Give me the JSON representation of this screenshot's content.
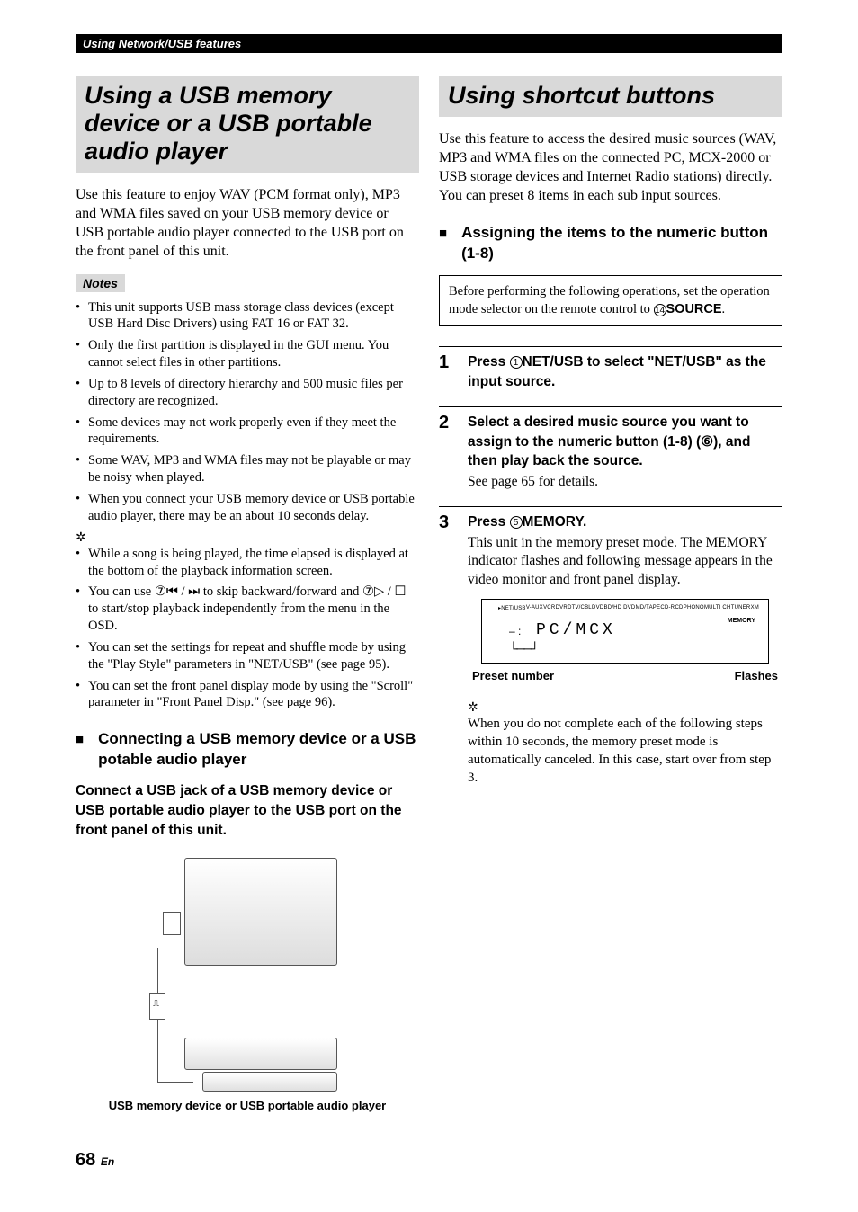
{
  "header": {
    "breadcrumb": "Using Network/USB features"
  },
  "left": {
    "title": "Using a USB memory device or a USB portable audio player",
    "intro": "Use this feature to enjoy WAV (PCM format only), MP3 and WMA files saved on your USB memory device or USB portable audio player connected to the USB port on the front panel of this unit.",
    "notes_label": "Notes",
    "notes": [
      "This unit supports USB mass storage class devices (except USB Hard Disc Drivers) using FAT 16 or FAT 32.",
      "Only the first partition is displayed in the GUI menu. You cannot select files in other partitions.",
      "Up to 8 levels of directory hierarchy and 500 music files per directory are recognized.",
      "Some devices may not work properly even if they meet the requirements.",
      "Some WAV, MP3 and WMA files may not be playable or may be noisy when played.",
      "When you connect your USB memory device or USB portable audio player, there may be an about 10 seconds delay."
    ],
    "tips": [
      "While a song is being played, the time elapsed is displayed at the bottom of the playback information screen.",
      "You can use ⑦⏮ / ⏭ to skip backward/forward and ⑦▷ / ☐ to start/stop playback independently from the menu in the OSD.",
      "You can set the settings for repeat and shuffle mode by using the \"Play Style\" parameters in \"NET/USB\" (see page 95).",
      "You can set the front panel display mode by using the \"Scroll\" parameter in \"Front Panel Disp.\" (see page 96)."
    ],
    "subhead": "Connecting a USB memory device or a USB potable audio player",
    "instruction": "Connect a USB jack of a USB memory device or USB portable audio player to the USB port on the front panel of this unit.",
    "caption": "USB memory device or USB portable audio player"
  },
  "right": {
    "title": "Using shortcut buttons",
    "intro": "Use this feature to access the desired music sources (WAV, MP3 and WMA files on the connected PC, MCX-2000 or USB storage devices and Internet Radio stations) directly. You can preset 8 items in each sub input sources.",
    "subhead": "Assigning the items to the numeric button (1-8)",
    "opbox_pre": "Before performing the following operations, set the operation mode selector on the remote control to ",
    "opbox_src": "SOURCE",
    "opbox_post": ".",
    "steps": [
      {
        "num": "1",
        "bold_pre": "Press ",
        "bold_btn": "NET/USB",
        "bold_post": " to select \"NET/USB\" as the input source.",
        "circ": "1"
      },
      {
        "num": "2",
        "bold": "Select a desired music source you want to assign to the numeric button (1-8) (⑥), and then play back the source.",
        "reg": "See page 65 for details."
      },
      {
        "num": "3",
        "bold_pre": "Press ",
        "bold_btn": "MEMORY",
        "bold_post": ".",
        "circ": "5",
        "reg": "This unit in the memory preset mode. The MEMORY indicator flashes and following message appears in the video monitor and front panel display."
      }
    ],
    "display": {
      "top_items": [
        "▸NET/USB",
        "V-AUX",
        "VCR",
        "DVR",
        "DTV/CBL",
        "DVD",
        "BD/HD DVD",
        "MD/TAPE",
        "CD-R",
        "CD",
        "PHONO",
        "MULTI CH",
        "TUNER",
        "XM"
      ],
      "main": "PC/MCX",
      "mem": "MEMORY",
      "preset_label": "Preset number",
      "flashes_label": "Flashes"
    },
    "tip": "When you do not complete each of the following steps within 10 seconds, the memory preset mode is automatically canceled. In this case, start over from step 3."
  },
  "footer": {
    "page": "68",
    "lang": "En"
  }
}
